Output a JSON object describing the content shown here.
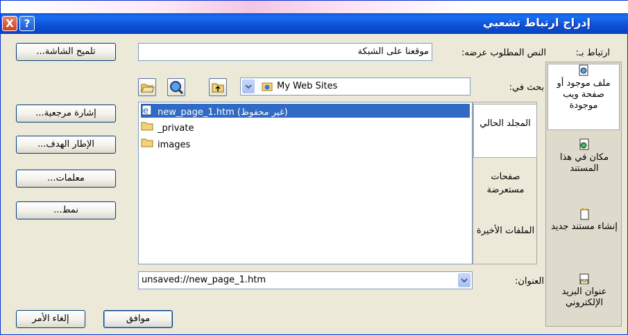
{
  "window": {
    "title": "إدراج ارتباط تشعبي",
    "help_label": "?",
    "close_label": "X"
  },
  "link_to": {
    "label": "ارتباط بـ:",
    "items": [
      {
        "label": "ملف موجود أو صفحة ويب موجودة",
        "icon": "existing-file-icon",
        "selected": true
      },
      {
        "label": "مكان في هذا المستند",
        "icon": "place-in-document-icon",
        "selected": false
      },
      {
        "label": "إنشاء مستند جديد",
        "icon": "new-document-icon",
        "selected": false
      },
      {
        "label": "عنوان البريد الإلكتروني",
        "icon": "email-address-icon",
        "selected": false
      }
    ]
  },
  "text_to_display": {
    "label": "النص المطلوب عرضه:",
    "value": "موقعنا على الشبكة"
  },
  "screentip_button": "تلميح الشاشة...",
  "look_in": {
    "label": "بحث في:",
    "value": "My Web Sites"
  },
  "view_tabs": [
    {
      "label": "المجلد الحالي",
      "selected": true
    },
    {
      "label": "صفحات مستعرضة",
      "selected": false
    },
    {
      "label": "الملفات الأخيرة",
      "selected": false
    }
  ],
  "files": [
    {
      "name": "new_page_1.htm (غير محفوظ)",
      "icon": "html-page-icon",
      "selected": true
    },
    {
      "name": "_private",
      "icon": "folder-icon",
      "selected": false
    },
    {
      "name": "images",
      "icon": "folder-icon",
      "selected": false
    }
  ],
  "side_buttons": {
    "bookmark": "إشارة مرجعية...",
    "target_frame": "الإطار الهدف...",
    "parameters": "معلمات...",
    "style": "نمط..."
  },
  "address": {
    "label": "العنوان:",
    "value": "unsaved://new_page_1.htm"
  },
  "ok_button": "موافق",
  "cancel_button": "إلغاء الأمر",
  "colors": {
    "titlebar": "#0a5fe0",
    "selection": "#316ac5",
    "dialog_bg": "#ece9d8"
  }
}
